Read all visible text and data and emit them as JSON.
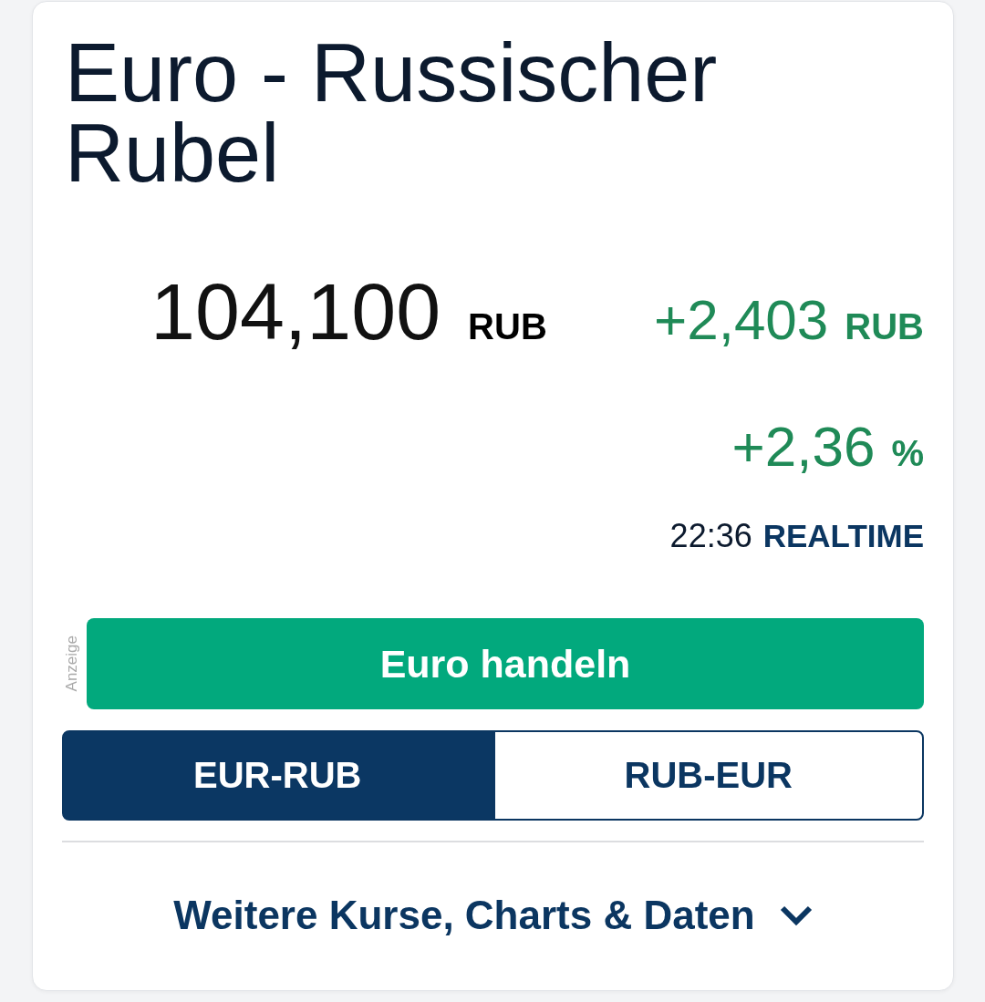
{
  "title": "Euro - Russischer Rubel",
  "quote": {
    "price": "104,100",
    "price_unit": "RUB",
    "change": "+2,403",
    "change_unit": "RUB",
    "change_percent": "+2,36",
    "percent_unit": "%",
    "positive": true,
    "time": "22:36",
    "source": "REALTIME"
  },
  "ad": {
    "label": "Anzeige",
    "button": "Euro handeln"
  },
  "tabs": [
    {
      "label": "EUR-RUB",
      "selected": true
    },
    {
      "label": "RUB-EUR",
      "selected": false
    }
  ],
  "more_link": {
    "label": "Weitere Kurse, Charts & Daten",
    "expanded": false
  }
}
